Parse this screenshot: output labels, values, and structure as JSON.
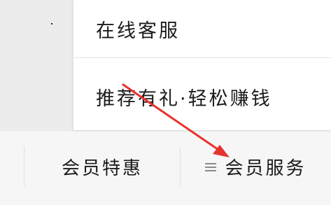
{
  "popup_menu": {
    "items": [
      {
        "label": "在线客服"
      },
      {
        "label": "推荐有礼·轻松赚钱"
      }
    ]
  },
  "bottom_bar": {
    "items": [
      {
        "label": "会员特惠"
      },
      {
        "label": "会员服务",
        "icon": "menu-icon"
      }
    ]
  },
  "annotation": {
    "arrow_color": "#e8322e"
  },
  "colors": {
    "background": "#ececec",
    "popup_background": "#ffffff",
    "bar_background": "#f6f6f6",
    "text": "#1a1a1a",
    "icon": "#8a8a8a"
  }
}
